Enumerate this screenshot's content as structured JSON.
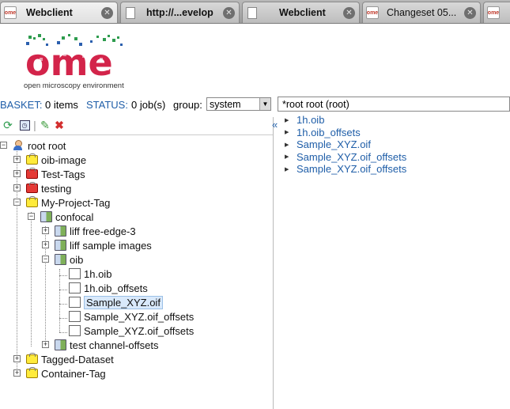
{
  "tabs": [
    {
      "title": "Webclient",
      "favicon": "ome-icon",
      "active": true
    },
    {
      "title": "http://...evelop",
      "favicon": "page-icon",
      "active": false
    },
    {
      "title": "Webclient",
      "favicon": "page-icon",
      "active": false
    },
    {
      "title": "Changeset 05...",
      "favicon": "ome-icon",
      "active": false
    },
    {
      "title": "",
      "favicon": "ome-icon",
      "active": false
    }
  ],
  "logo": {
    "text": "open microscopy environment",
    "wordmark": "ome"
  },
  "status": {
    "basket_label": "BASKET:",
    "basket_value": "0 items",
    "status_label": "STATUS:",
    "status_value": "0 job(s)",
    "group_label": "group:",
    "group_value": "system",
    "user_value": "*root root (root)"
  },
  "tree": {
    "root": "root root",
    "items": [
      {
        "label": "oib-image"
      },
      {
        "label": "Test-Tags"
      },
      {
        "label": "testing"
      },
      {
        "label": "My-Project-Tag"
      },
      {
        "label": "confocal"
      },
      {
        "label": "liff free-edge-3"
      },
      {
        "label": "liff sample images"
      },
      {
        "label": "oib"
      },
      {
        "label": "1h.oib"
      },
      {
        "label": "1h.oib_offsets"
      },
      {
        "label": "Sample_XYZ.oif"
      },
      {
        "label": "Sample_XYZ.oif_offsets"
      },
      {
        "label": "Sample_XYZ.oif_offsets"
      },
      {
        "label": "test channel-offsets"
      },
      {
        "label": "Tagged-Dataset"
      },
      {
        "label": "Container-Tag"
      }
    ]
  },
  "right_list": [
    "1h.oib",
    "1h.oib_offsets",
    "Sample_XYZ.oif",
    "Sample_XYZ.oif_offsets",
    "Sample_XYZ.oif_offsets"
  ]
}
